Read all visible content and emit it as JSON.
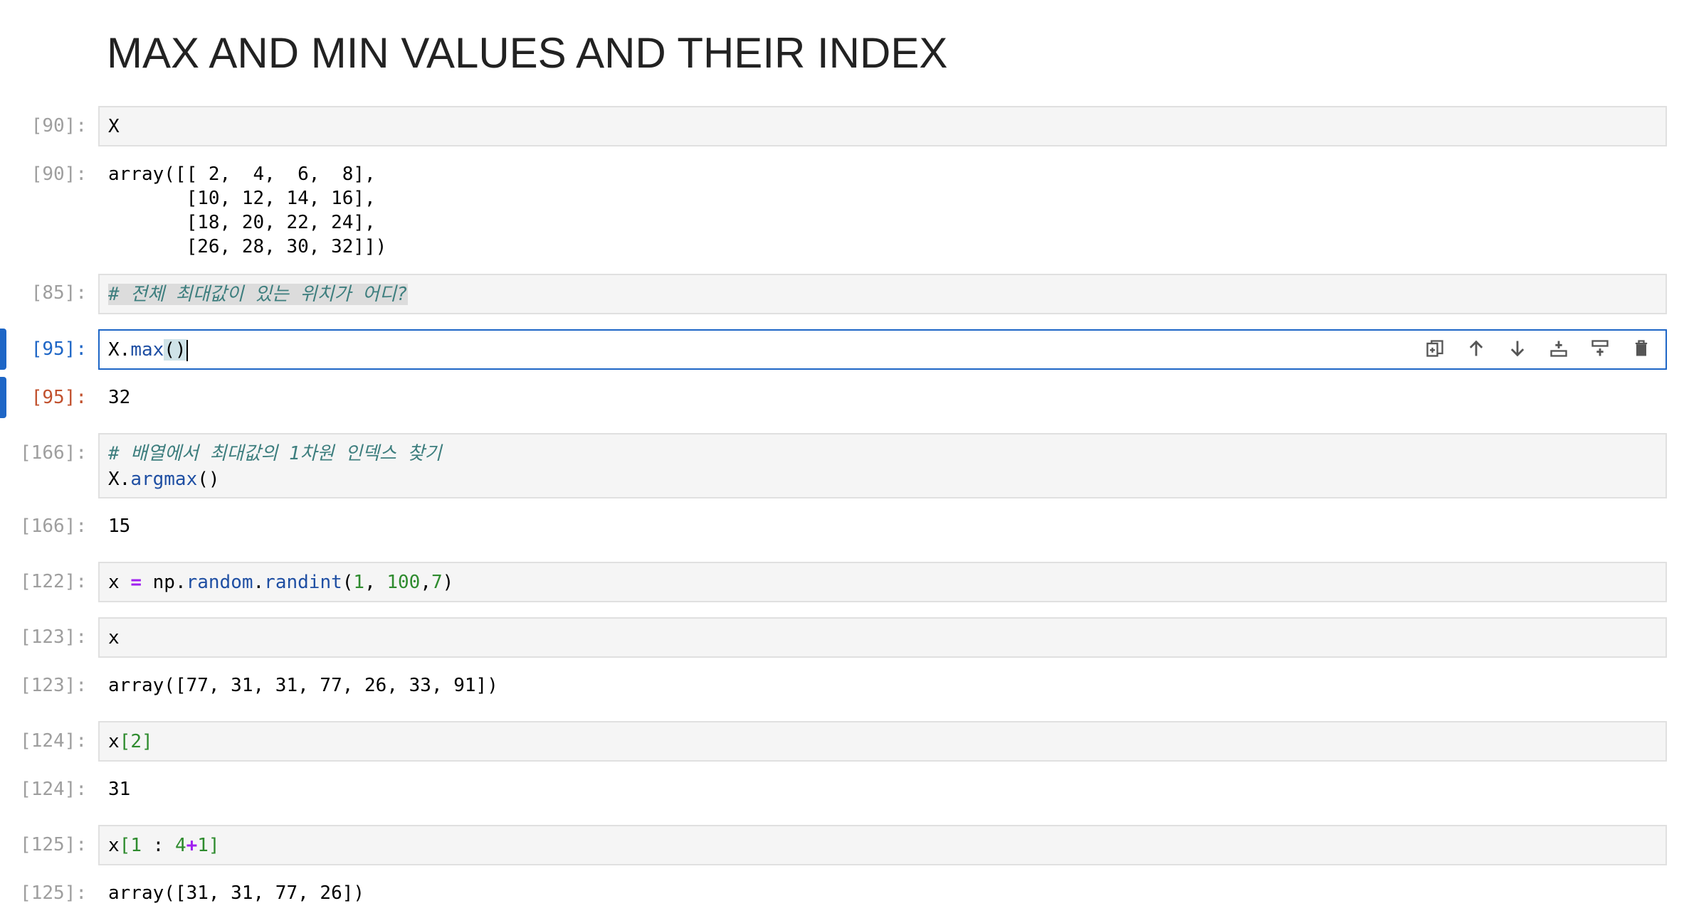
{
  "heading": "MAX AND MIN VALUES AND THEIR INDEX",
  "cells": {
    "c90_in_prompt": "[90]:",
    "c90_code": "X",
    "c90_out_prompt": "[90]:",
    "c90_out": "array([[ 2,  4,  6,  8],\n       [10, 12, 14, 16],\n       [18, 20, 22, 24],\n       [26, 28, 30, 32]])",
    "c85_in_prompt": "[85]:",
    "c85_comment": "# 전체 최대값이 있는 위치가 어디?",
    "c95_in_prompt": "[95]:",
    "c95_obj": "X",
    "c95_dot": ".",
    "c95_method": "max",
    "c95_parens": "()",
    "c95_out_prompt": "[95]:",
    "c95_out": "32",
    "c166_in_prompt": "[166]:",
    "c166_comment": "# 배열에서 최대값의 1차원 인덱스 찾기",
    "c166_obj": "X",
    "c166_dot": ".",
    "c166_method": "argmax",
    "c166_parens": "()",
    "c166_out_prompt": "[166]:",
    "c166_out": "15",
    "c122_in_prompt": "[122]:",
    "c122_var": "x",
    "c122_eq": "=",
    "c122_np": "np",
    "c122_dot1": ".",
    "c122_random": "random",
    "c122_dot2": ".",
    "c122_randint": "randint",
    "c122_open": "(",
    "c122_a1": "1",
    "c122_comma1": ", ",
    "c122_a2": "100",
    "c122_comma2": ",",
    "c122_a3": "7",
    "c122_close": ")",
    "c123_in_prompt": "[123]:",
    "c123_code": "x",
    "c123_out_prompt": "[123]:",
    "c123_out": "array([77, 31, 31, 77, 26, 33, 91])",
    "c124_in_prompt": "[124]:",
    "c124_var": "x",
    "c124_lb": "[",
    "c124_idx": "2",
    "c124_rb": "]",
    "c124_out_prompt": "[124]:",
    "c124_out": "31",
    "c125_in_prompt": "[125]:",
    "c125_var": "x",
    "c125_lb": "[",
    "c125_a": "1",
    "c125_colon": " : ",
    "c125_b": "4",
    "c125_plus": "+",
    "c125_c": "1",
    "c125_rb": "]",
    "c125_out_prompt": "[125]:",
    "c125_out": "array([31, 31, 77, 26])"
  },
  "toolbar_icons": [
    "duplicate-icon",
    "move-up-icon",
    "move-down-icon",
    "insert-above-icon",
    "insert-below-icon",
    "delete-icon"
  ],
  "colors": {
    "accent": "#1e66c6",
    "out_prompt_active": "#c1512e",
    "cell_bg": "#f5f5f5"
  }
}
